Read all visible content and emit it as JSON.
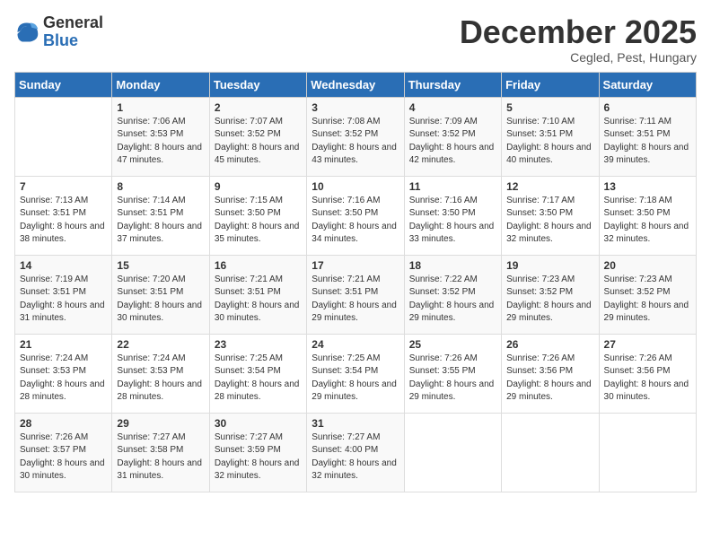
{
  "logo": {
    "general": "General",
    "blue": "Blue"
  },
  "title": "December 2025",
  "location": "Cegled, Pest, Hungary",
  "days_of_week": [
    "Sunday",
    "Monday",
    "Tuesday",
    "Wednesday",
    "Thursday",
    "Friday",
    "Saturday"
  ],
  "weeks": [
    [
      {
        "day": "",
        "sunrise": "",
        "sunset": "",
        "daylight": ""
      },
      {
        "day": "1",
        "sunrise": "Sunrise: 7:06 AM",
        "sunset": "Sunset: 3:53 PM",
        "daylight": "Daylight: 8 hours and 47 minutes."
      },
      {
        "day": "2",
        "sunrise": "Sunrise: 7:07 AM",
        "sunset": "Sunset: 3:52 PM",
        "daylight": "Daylight: 8 hours and 45 minutes."
      },
      {
        "day": "3",
        "sunrise": "Sunrise: 7:08 AM",
        "sunset": "Sunset: 3:52 PM",
        "daylight": "Daylight: 8 hours and 43 minutes."
      },
      {
        "day": "4",
        "sunrise": "Sunrise: 7:09 AM",
        "sunset": "Sunset: 3:52 PM",
        "daylight": "Daylight: 8 hours and 42 minutes."
      },
      {
        "day": "5",
        "sunrise": "Sunrise: 7:10 AM",
        "sunset": "Sunset: 3:51 PM",
        "daylight": "Daylight: 8 hours and 40 minutes."
      },
      {
        "day": "6",
        "sunrise": "Sunrise: 7:11 AM",
        "sunset": "Sunset: 3:51 PM",
        "daylight": "Daylight: 8 hours and 39 minutes."
      }
    ],
    [
      {
        "day": "7",
        "sunrise": "Sunrise: 7:13 AM",
        "sunset": "Sunset: 3:51 PM",
        "daylight": "Daylight: 8 hours and 38 minutes."
      },
      {
        "day": "8",
        "sunrise": "Sunrise: 7:14 AM",
        "sunset": "Sunset: 3:51 PM",
        "daylight": "Daylight: 8 hours and 37 minutes."
      },
      {
        "day": "9",
        "sunrise": "Sunrise: 7:15 AM",
        "sunset": "Sunset: 3:50 PM",
        "daylight": "Daylight: 8 hours and 35 minutes."
      },
      {
        "day": "10",
        "sunrise": "Sunrise: 7:16 AM",
        "sunset": "Sunset: 3:50 PM",
        "daylight": "Daylight: 8 hours and 34 minutes."
      },
      {
        "day": "11",
        "sunrise": "Sunrise: 7:16 AM",
        "sunset": "Sunset: 3:50 PM",
        "daylight": "Daylight: 8 hours and 33 minutes."
      },
      {
        "day": "12",
        "sunrise": "Sunrise: 7:17 AM",
        "sunset": "Sunset: 3:50 PM",
        "daylight": "Daylight: 8 hours and 32 minutes."
      },
      {
        "day": "13",
        "sunrise": "Sunrise: 7:18 AM",
        "sunset": "Sunset: 3:50 PM",
        "daylight": "Daylight: 8 hours and 32 minutes."
      }
    ],
    [
      {
        "day": "14",
        "sunrise": "Sunrise: 7:19 AM",
        "sunset": "Sunset: 3:51 PM",
        "daylight": "Daylight: 8 hours and 31 minutes."
      },
      {
        "day": "15",
        "sunrise": "Sunrise: 7:20 AM",
        "sunset": "Sunset: 3:51 PM",
        "daylight": "Daylight: 8 hours and 30 minutes."
      },
      {
        "day": "16",
        "sunrise": "Sunrise: 7:21 AM",
        "sunset": "Sunset: 3:51 PM",
        "daylight": "Daylight: 8 hours and 30 minutes."
      },
      {
        "day": "17",
        "sunrise": "Sunrise: 7:21 AM",
        "sunset": "Sunset: 3:51 PM",
        "daylight": "Daylight: 8 hours and 29 minutes."
      },
      {
        "day": "18",
        "sunrise": "Sunrise: 7:22 AM",
        "sunset": "Sunset: 3:52 PM",
        "daylight": "Daylight: 8 hours and 29 minutes."
      },
      {
        "day": "19",
        "sunrise": "Sunrise: 7:23 AM",
        "sunset": "Sunset: 3:52 PM",
        "daylight": "Daylight: 8 hours and 29 minutes."
      },
      {
        "day": "20",
        "sunrise": "Sunrise: 7:23 AM",
        "sunset": "Sunset: 3:52 PM",
        "daylight": "Daylight: 8 hours and 29 minutes."
      }
    ],
    [
      {
        "day": "21",
        "sunrise": "Sunrise: 7:24 AM",
        "sunset": "Sunset: 3:53 PM",
        "daylight": "Daylight: 8 hours and 28 minutes."
      },
      {
        "day": "22",
        "sunrise": "Sunrise: 7:24 AM",
        "sunset": "Sunset: 3:53 PM",
        "daylight": "Daylight: 8 hours and 28 minutes."
      },
      {
        "day": "23",
        "sunrise": "Sunrise: 7:25 AM",
        "sunset": "Sunset: 3:54 PM",
        "daylight": "Daylight: 8 hours and 28 minutes."
      },
      {
        "day": "24",
        "sunrise": "Sunrise: 7:25 AM",
        "sunset": "Sunset: 3:54 PM",
        "daylight": "Daylight: 8 hours and 29 minutes."
      },
      {
        "day": "25",
        "sunrise": "Sunrise: 7:26 AM",
        "sunset": "Sunset: 3:55 PM",
        "daylight": "Daylight: 8 hours and 29 minutes."
      },
      {
        "day": "26",
        "sunrise": "Sunrise: 7:26 AM",
        "sunset": "Sunset: 3:56 PM",
        "daylight": "Daylight: 8 hours and 29 minutes."
      },
      {
        "day": "27",
        "sunrise": "Sunrise: 7:26 AM",
        "sunset": "Sunset: 3:56 PM",
        "daylight": "Daylight: 8 hours and 30 minutes."
      }
    ],
    [
      {
        "day": "28",
        "sunrise": "Sunrise: 7:26 AM",
        "sunset": "Sunset: 3:57 PM",
        "daylight": "Daylight: 8 hours and 30 minutes."
      },
      {
        "day": "29",
        "sunrise": "Sunrise: 7:27 AM",
        "sunset": "Sunset: 3:58 PM",
        "daylight": "Daylight: 8 hours and 31 minutes."
      },
      {
        "day": "30",
        "sunrise": "Sunrise: 7:27 AM",
        "sunset": "Sunset: 3:59 PM",
        "daylight": "Daylight: 8 hours and 32 minutes."
      },
      {
        "day": "31",
        "sunrise": "Sunrise: 7:27 AM",
        "sunset": "Sunset: 4:00 PM",
        "daylight": "Daylight: 8 hours and 32 minutes."
      },
      {
        "day": "",
        "sunrise": "",
        "sunset": "",
        "daylight": ""
      },
      {
        "day": "",
        "sunrise": "",
        "sunset": "",
        "daylight": ""
      },
      {
        "day": "",
        "sunrise": "",
        "sunset": "",
        "daylight": ""
      }
    ]
  ]
}
